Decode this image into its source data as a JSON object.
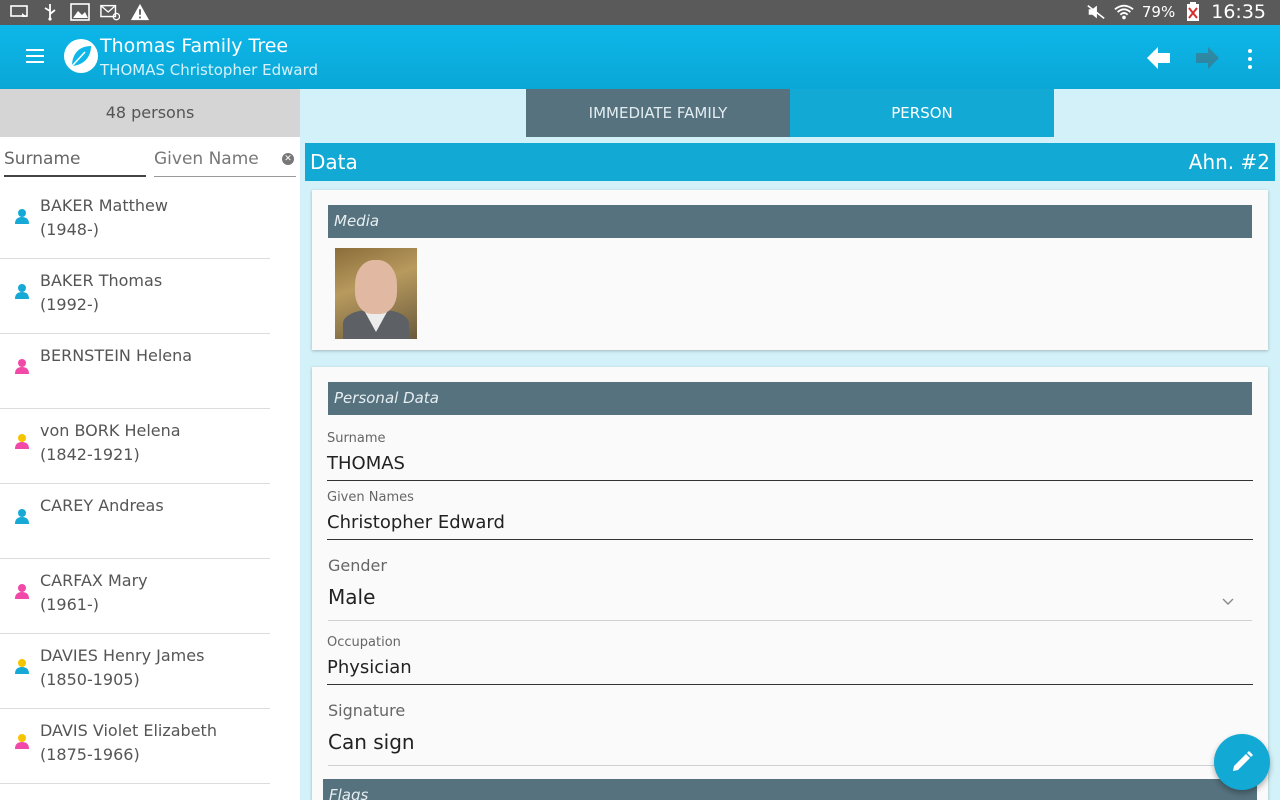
{
  "status_bar": {
    "battery": "79%",
    "time": "16:35"
  },
  "app_bar": {
    "title": "Thomas Family Tree",
    "subtitle": "THOMAS Christopher Edward"
  },
  "left_panel": {
    "count": "48 persons",
    "surname_placeholder": "Surname",
    "given_placeholder": "Given Name",
    "persons": [
      {
        "name": "BAKER Matthew",
        "dates": "(1948-)",
        "gender": "male"
      },
      {
        "name": "BAKER Thomas",
        "dates": "(1992-)",
        "gender": "male"
      },
      {
        "name": "BERNSTEIN Helena",
        "dates": "",
        "gender": "female"
      },
      {
        "name": "von BORK Helena",
        "dates": "(1842-1921)",
        "gender": "female-ancestor"
      },
      {
        "name": "CAREY Andreas",
        "dates": "",
        "gender": "male"
      },
      {
        "name": "CARFAX Mary",
        "dates": "(1961-)",
        "gender": "female"
      },
      {
        "name": "DAVIES Henry James",
        "dates": "(1850-1905)",
        "gender": "male-ancestor"
      },
      {
        "name": "DAVIS Violet Elizabeth",
        "dates": "(1875-1966)",
        "gender": "female-ancestor"
      }
    ]
  },
  "tabs": [
    {
      "label": "IMMEDIATE FAMILY",
      "active": false
    },
    {
      "label": "PERSON",
      "active": true
    }
  ],
  "data_bar": {
    "left": "Data",
    "right": "Ahn. #2"
  },
  "media": {
    "heading": "Media"
  },
  "personal": {
    "heading": "Personal Data",
    "surname_label": "Surname",
    "surname_value": "THOMAS",
    "given_label": "Given Names",
    "given_value": "Christopher Edward",
    "gender_label": "Gender",
    "gender_value": "Male",
    "occupation_label": "Occupation",
    "occupation_value": "Physician",
    "signature_label": "Signature",
    "signature_value": "Can sign"
  },
  "flags": {
    "heading": "Flags"
  },
  "colors": {
    "accent": "#12a9d4",
    "section": "#56727e",
    "male": "#16a9d6",
    "female": "#f049a8",
    "ancestor": "#f5c400"
  }
}
